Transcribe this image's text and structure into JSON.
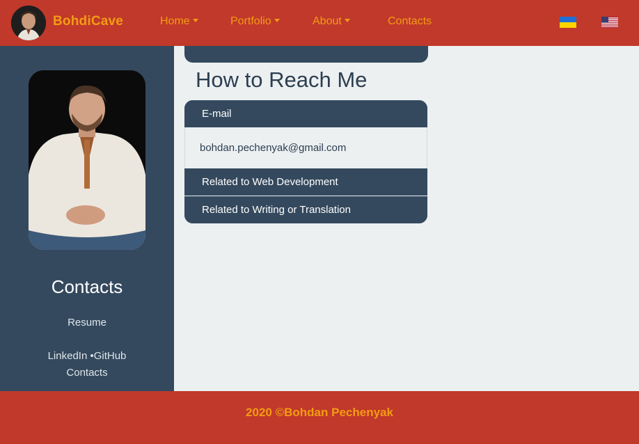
{
  "navbar": {
    "brand": "BohdiCave",
    "items": [
      {
        "label": "Home",
        "dropdown": true
      },
      {
        "label": "Portfolio",
        "dropdown": true
      },
      {
        "label": "About",
        "dropdown": true
      },
      {
        "label": "Contacts",
        "dropdown": false
      }
    ],
    "languages": [
      "uk-flag-icon",
      "us-flag-icon"
    ]
  },
  "sidebar": {
    "title": "Contacts",
    "links": [
      "Resume",
      "LinkedIn •GitHub",
      "Contacts"
    ]
  },
  "main": {
    "title": "How to Reach Me",
    "accordion": [
      {
        "label": "E-mail",
        "content": "bohdan.pechenyak@gmail.com",
        "expanded": true
      },
      {
        "label": "Related to Web Development",
        "expanded": false
      },
      {
        "label": "Related to Writing or Translation",
        "expanded": false
      }
    ]
  },
  "footer": {
    "text": "2020 ©Bohdan Pechenyak"
  },
  "colors": {
    "primary": "#c0392b",
    "accent": "#f39c12",
    "dark": "#34495e",
    "light": "#ecf0f1"
  }
}
